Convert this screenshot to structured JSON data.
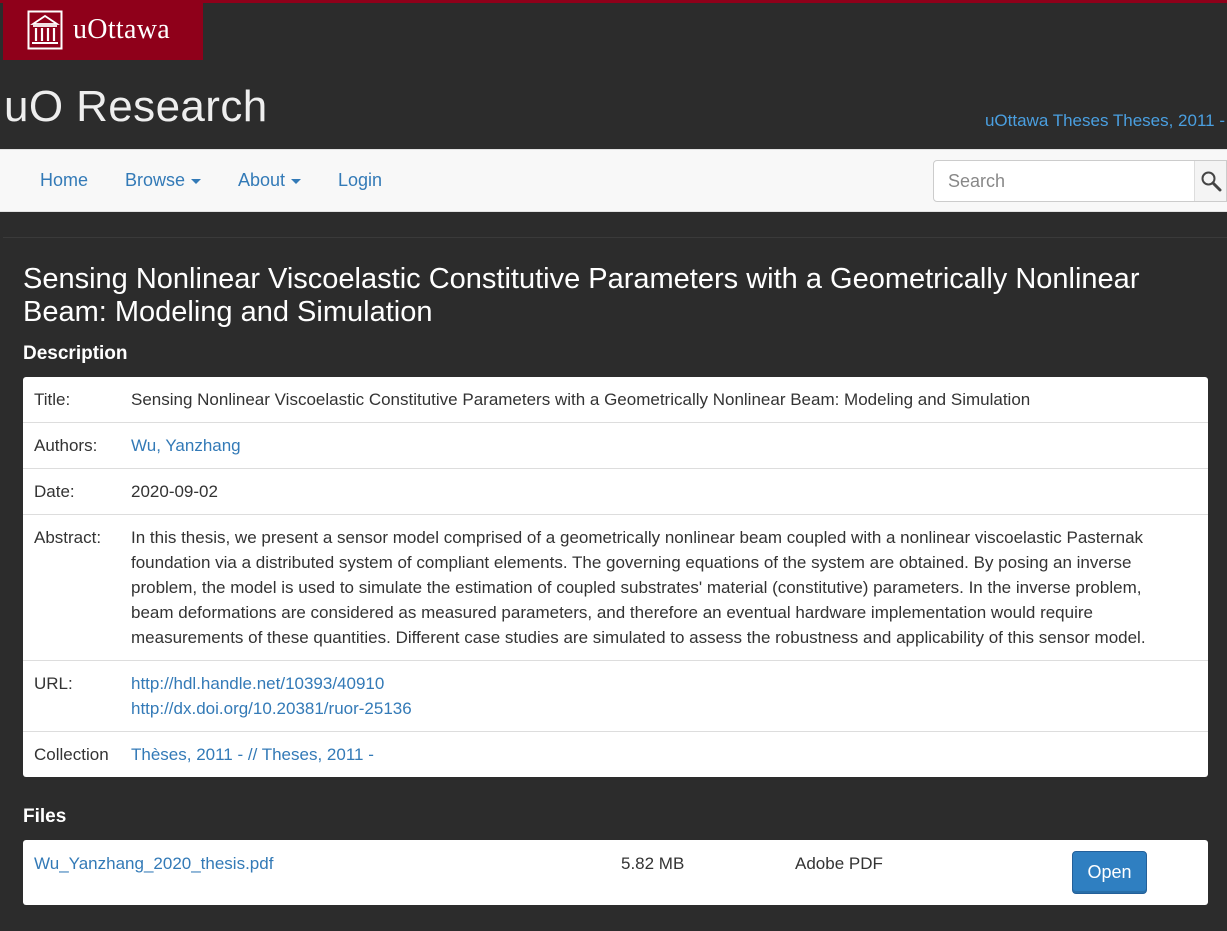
{
  "brand": {
    "logo_icon": "university-building-icon",
    "logo_text": "uOttawa",
    "site_title": "uO Research",
    "collection_link": "uOttawa Theses Theses, 2011 -",
    "colors": {
      "brand_red": "#8f001a",
      "link_blue": "#337ab7",
      "dark_bg": "#2c2c2c"
    }
  },
  "nav": {
    "home": "Home",
    "browse": "Browse",
    "about": "About",
    "login": "Login",
    "search_placeholder": "Search",
    "search_icon": "magnifier-icon"
  },
  "item": {
    "title": "Sensing Nonlinear Viscoelastic Constitutive Parameters with a Geometrically Nonlinear Beam: Modeling and Simulation",
    "description_heading": "Description",
    "fields": {
      "title_label": "Title:",
      "title_value": "Sensing Nonlinear Viscoelastic Constitutive Parameters with a Geometrically Nonlinear Beam: Modeling and Simulation",
      "authors_label": "Authors:",
      "authors_value": "Wu, Yanzhang",
      "date_label": "Date:",
      "date_value": "2020-09-02",
      "abstract_label": "Abstract:",
      "abstract_value": "In this thesis, we present a sensor model comprised of a geometrically nonlinear beam coupled with a nonlinear viscoelastic Pasternak foundation via a distributed system of compliant elements. The governing equations of the system are obtained. By posing an inverse problem, the model is used to simulate the estimation of coupled substrates' material (constitutive) parameters. In the inverse problem, beam deformations are considered as measured parameters, and therefore an eventual hardware implementation would require measurements of these quantities. Different case studies are simulated to assess the robustness and applicability of this sensor model.",
      "url_label": "URL:",
      "url_1": "http://hdl.handle.net/10393/40910",
      "url_2": "http://dx.doi.org/10.20381/ruor-25136",
      "collection_label": "Collection",
      "collection_value": "Thèses, 2011 - // Theses, 2011 -"
    },
    "files_heading": "Files",
    "files": [
      {
        "name": "Wu_Yanzhang_2020_thesis.pdf",
        "size": "5.82 MB",
        "type": "Adobe PDF",
        "action": "Open"
      }
    ]
  }
}
